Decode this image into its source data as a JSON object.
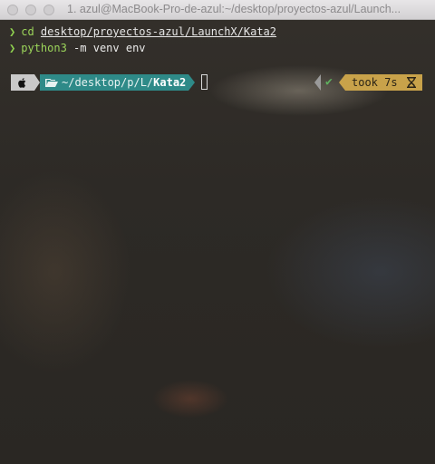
{
  "window": {
    "title": "1. azul@MacBook-Pro-de-azul:~/desktop/proyectos-azul/Launch..."
  },
  "terminal": {
    "lines": [
      {
        "prompt_symbol": "❯",
        "command": "cd",
        "argument": "desktop/proyectos-azul/LaunchX/Kata2"
      },
      {
        "prompt_symbol": "❯",
        "command": "python3",
        "argument": "-m venv env"
      }
    ],
    "prompt": {
      "os_icon": "apple-icon",
      "folder_icon": "folder-open-icon",
      "path_prefix": "~/desktop/p/L/",
      "path_current": "Kata2",
      "status_icon": "check-icon",
      "status_symbol": "✔",
      "duration_text": "took 7s",
      "duration_icon": "hourglass-icon"
    }
  },
  "colors": {
    "prompt_green": "#8fd14f",
    "path_segment": "#2e8a88",
    "os_segment": "#c9c9c9",
    "duration_segment": "#c8a24a",
    "status_ok": "#5fb05f"
  }
}
